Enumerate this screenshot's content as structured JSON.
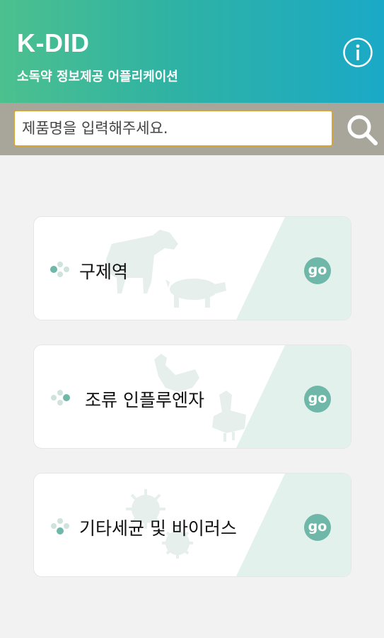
{
  "header": {
    "title": "K-DID",
    "subtitle": "소독약 정보제공 어플리케이션",
    "info_icon": "info-icon"
  },
  "search": {
    "placeholder": "제품명을 입력해주세요.",
    "value": "",
    "icon": "search-icon"
  },
  "categories": [
    {
      "label": "구제역",
      "go_label": "go",
      "illustration": "cattle-pig-icon"
    },
    {
      "label": "조류 인플루엔자",
      "go_label": "go",
      "illustration": "chicken-duck-icon"
    },
    {
      "label": "기타세균 및 바이러스",
      "go_label": "go",
      "illustration": "virus-icon"
    }
  ],
  "colors": {
    "header_gradient": [
      "#4cc08e",
      "#1aa9c7"
    ],
    "search_bar_bg": "#a8a59b",
    "search_border": "#d4a53a",
    "accent": "#6fb8a9",
    "card_diagonal": "#e3f1ec"
  }
}
